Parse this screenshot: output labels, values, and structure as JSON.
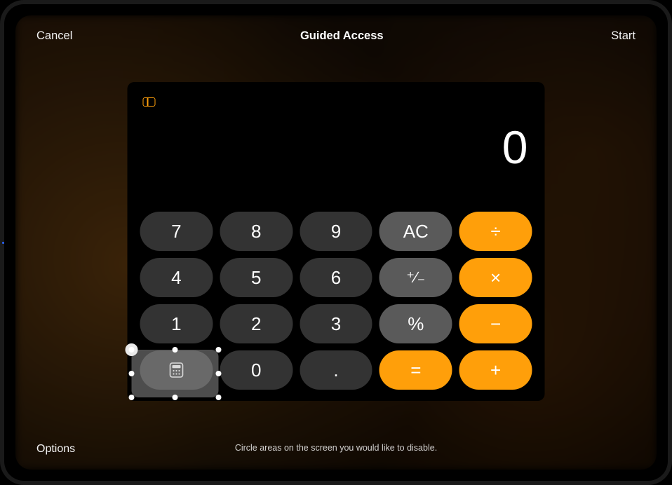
{
  "nav": {
    "cancel": "Cancel",
    "title": "Guided Access",
    "start": "Start"
  },
  "calculator": {
    "display": "0",
    "keys": {
      "seven": "7",
      "eight": "8",
      "nine": "9",
      "ac": "AC",
      "four": "4",
      "five": "5",
      "six": "6",
      "one": "1",
      "two": "2",
      "three": "3",
      "zero": "0",
      "decimal": "."
    }
  },
  "footer": {
    "options": "Options",
    "hint": "Circle areas on the screen you would like to disable."
  },
  "region_close_glyph": "×"
}
